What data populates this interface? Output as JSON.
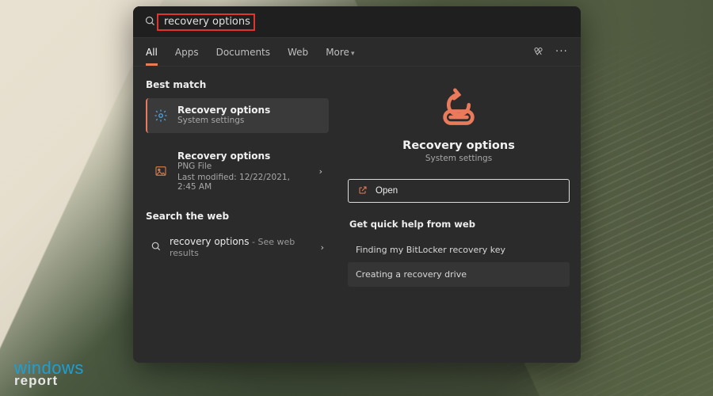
{
  "watermark": {
    "line1": "windows",
    "line2": "report"
  },
  "search": {
    "query": "recovery options"
  },
  "tabs": {
    "items": [
      "All",
      "Apps",
      "Documents",
      "Web",
      "More"
    ],
    "active": 0
  },
  "left": {
    "best_match_label": "Best match",
    "search_web_label": "Search the web",
    "results": [
      {
        "title": "Recovery options",
        "subtitle": "System settings",
        "meta": "",
        "selected": true,
        "icon": "settings"
      },
      {
        "title": "Recovery options",
        "subtitle": "PNG File",
        "meta": "Last modified: 12/22/2021, 2:45 AM",
        "selected": false,
        "icon": "image"
      }
    ],
    "web": {
      "query": "recovery options",
      "suffix": " - See web results"
    }
  },
  "preview": {
    "title": "Recovery options",
    "subtitle": "System settings",
    "open_label": "Open",
    "help_header": "Get quick help from web",
    "help_items": [
      "Finding my BitLocker recovery key",
      "Creating a recovery drive"
    ]
  }
}
